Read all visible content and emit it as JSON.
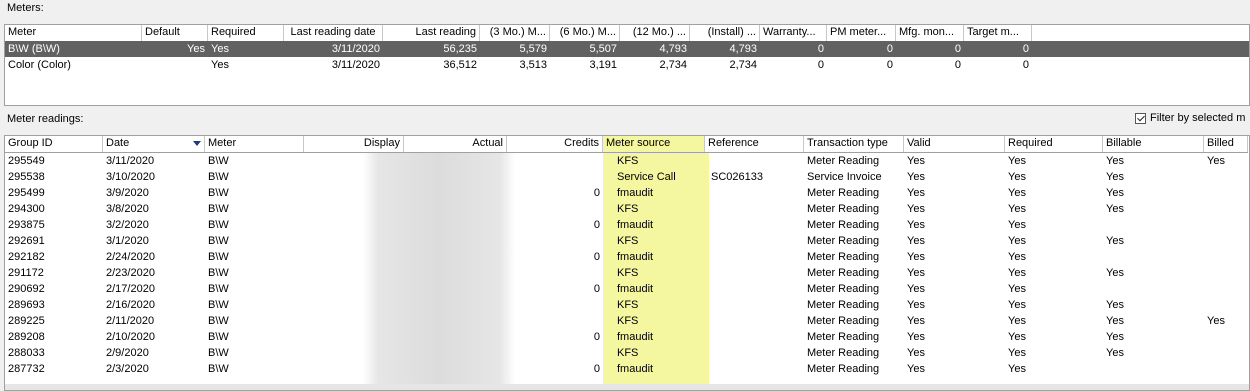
{
  "meters": {
    "label": "Meters:",
    "columns": [
      "Meter",
      "Default",
      "Required",
      "Last reading date",
      "Last reading",
      "(3 Mo.) M...",
      "(6 Mo.) M...",
      "(12 Mo.) ...",
      "(Install) ...",
      "Warranty...",
      "PM meter...",
      "Mfg. mon...",
      "Target m..."
    ],
    "rows": [
      [
        "B\\W (B\\W)",
        "Yes",
        "Yes",
        "3/11/2020",
        "56,235",
        "5,579",
        "5,507",
        "4,793",
        "4,793",
        "0",
        "0",
        "0",
        "0"
      ],
      [
        "Color (Color)",
        "",
        "Yes",
        "3/11/2020",
        "36,512",
        "3,513",
        "3,191",
        "2,734",
        "2,734",
        "0",
        "0",
        "0",
        "0"
      ]
    ]
  },
  "readings": {
    "label": "Meter readings:",
    "filter_label": "Filter by selected m",
    "filter_checked": true,
    "highlight_color": "#f5f7a0",
    "columns": [
      "Group ID",
      "Date",
      "Meter",
      "Display",
      "Actual",
      "Credits",
      "Meter source",
      "Reference",
      "Transaction type",
      "Valid",
      "Required",
      "Billable",
      "Billed"
    ],
    "rows": [
      [
        "295549",
        "3/11/2020",
        "B\\W",
        "",
        "",
        "",
        "KFS",
        "",
        "Meter Reading",
        "Yes",
        "Yes",
        "Yes",
        "Yes"
      ],
      [
        "295538",
        "3/10/2020",
        "B\\W",
        "",
        "",
        "",
        "Service Call",
        "SC026133",
        "Service Invoice",
        "Yes",
        "Yes",
        "Yes",
        ""
      ],
      [
        "295499",
        "3/9/2020",
        "B\\W",
        "",
        "",
        "0",
        "fmaudit",
        "",
        "Meter Reading",
        "Yes",
        "Yes",
        "Yes",
        ""
      ],
      [
        "294300",
        "3/8/2020",
        "B\\W",
        "",
        "",
        "",
        "KFS",
        "",
        "Meter Reading",
        "Yes",
        "Yes",
        "Yes",
        ""
      ],
      [
        "293875",
        "3/2/2020",
        "B\\W",
        "",
        "",
        "0",
        "fmaudit",
        "",
        "Meter Reading",
        "Yes",
        "Yes",
        "",
        ""
      ],
      [
        "292691",
        "3/1/2020",
        "B\\W",
        "",
        "",
        "",
        "KFS",
        "",
        "Meter Reading",
        "Yes",
        "Yes",
        "Yes",
        ""
      ],
      [
        "292182",
        "2/24/2020",
        "B\\W",
        "",
        "",
        "0",
        "fmaudit",
        "",
        "Meter Reading",
        "Yes",
        "Yes",
        "",
        ""
      ],
      [
        "291172",
        "2/23/2020",
        "B\\W",
        "",
        "",
        "",
        "KFS",
        "",
        "Meter Reading",
        "Yes",
        "Yes",
        "Yes",
        ""
      ],
      [
        "290692",
        "2/17/2020",
        "B\\W",
        "",
        "",
        "0",
        "fmaudit",
        "",
        "Meter Reading",
        "Yes",
        "Yes",
        "",
        ""
      ],
      [
        "289693",
        "2/16/2020",
        "B\\W",
        "",
        "",
        "",
        "KFS",
        "",
        "Meter Reading",
        "Yes",
        "Yes",
        "Yes",
        ""
      ],
      [
        "289225",
        "2/11/2020",
        "B\\W",
        "",
        "",
        "",
        "KFS",
        "",
        "Meter Reading",
        "Yes",
        "Yes",
        "Yes",
        "Yes"
      ],
      [
        "289208",
        "2/10/2020",
        "B\\W",
        "",
        "",
        "0",
        "fmaudit",
        "",
        "Meter Reading",
        "Yes",
        "Yes",
        "Yes",
        ""
      ],
      [
        "288033",
        "2/9/2020",
        "B\\W",
        "",
        "",
        "",
        "KFS",
        "",
        "Meter Reading",
        "Yes",
        "Yes",
        "Yes",
        ""
      ],
      [
        "287732",
        "2/3/2020",
        "B\\W",
        "",
        "",
        "0",
        "fmaudit",
        "",
        "Meter Reading",
        "Yes",
        "Yes",
        "",
        ""
      ]
    ]
  }
}
